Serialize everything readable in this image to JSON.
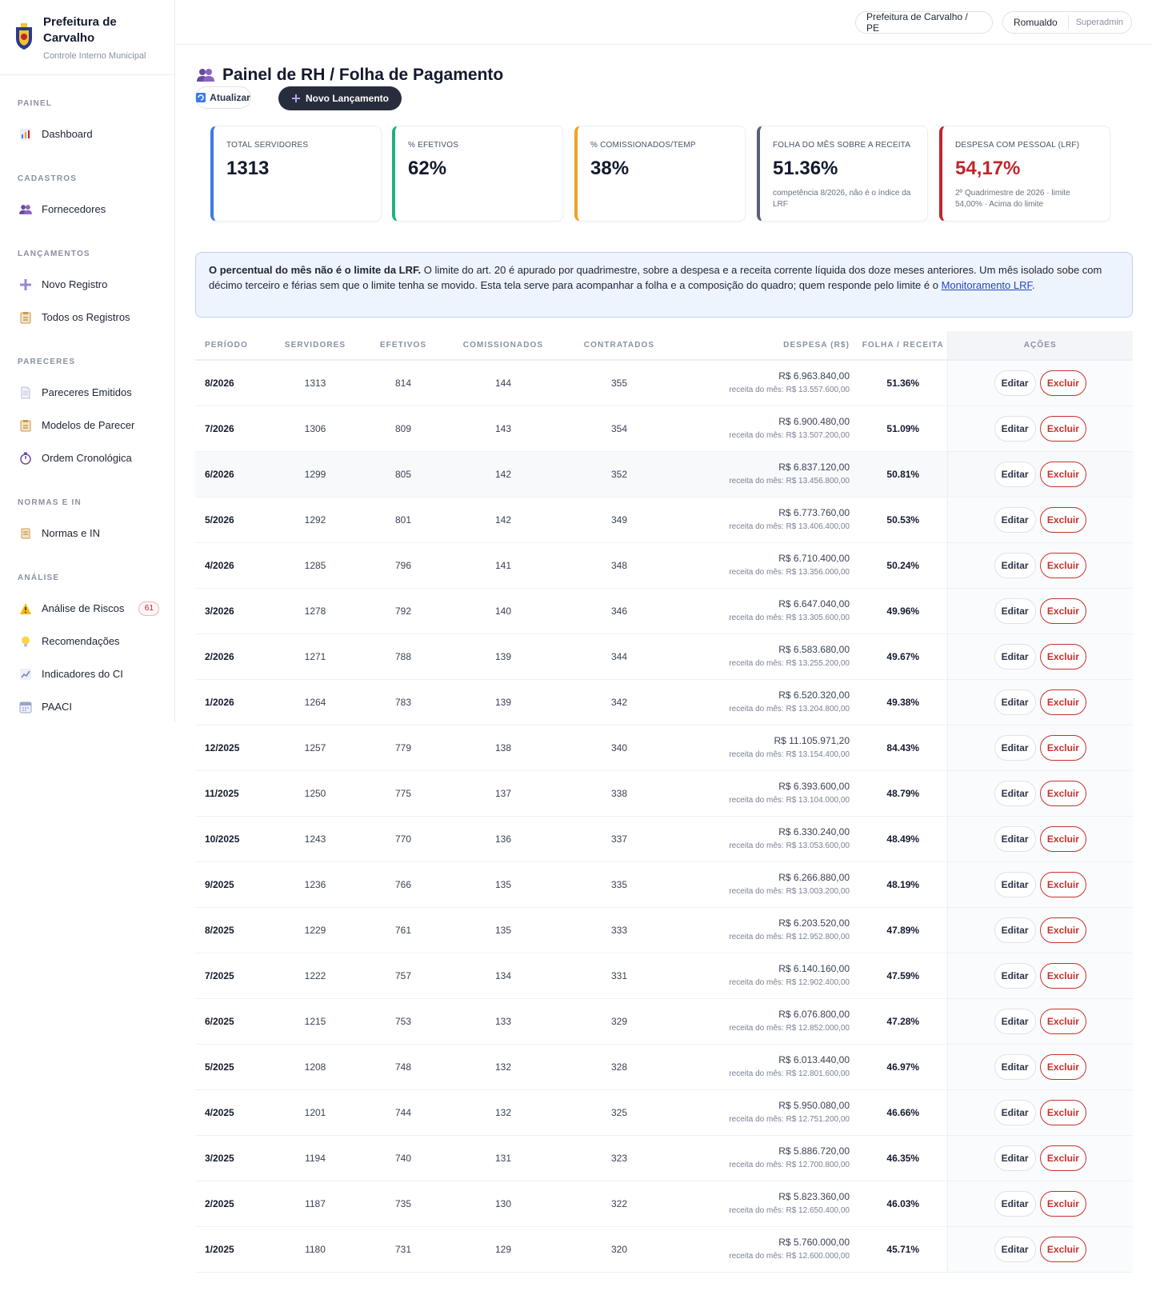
{
  "brand": {
    "title": "Prefeitura de Carvalho",
    "subtitle": "Controle Interno Municipal"
  },
  "sidebar": [
    {
      "heading": "PAINEL",
      "items": [
        {
          "label": "Dashboard",
          "icon": "bar-chart-icon"
        }
      ]
    },
    {
      "heading": "CADASTROS",
      "items": [
        {
          "label": "Fornecedores",
          "icon": "users-icon"
        }
      ]
    },
    {
      "heading": "LANÇAMENTOS",
      "items": [
        {
          "label": "Novo Registro",
          "icon": "plus-icon"
        },
        {
          "label": "Todos os Registros",
          "icon": "clipboard-icon"
        }
      ]
    },
    {
      "heading": "PARECERES",
      "items": [
        {
          "label": "Pareceres Emitidos",
          "icon": "document-icon"
        },
        {
          "label": "Modelos de Parecer",
          "icon": "clipboard-icon"
        },
        {
          "label": "Ordem Cronológica",
          "icon": "stopwatch-icon"
        }
      ]
    },
    {
      "heading": "NORMAS E IN",
      "items": [
        {
          "label": "Normas e IN",
          "icon": "scroll-icon"
        }
      ]
    },
    {
      "heading": "ANÁLISE",
      "items": [
        {
          "label": "Análise de Riscos",
          "icon": "warning-icon",
          "badge": "61"
        },
        {
          "label": "Recomendações",
          "icon": "lightbulb-icon"
        },
        {
          "label": "Indicadores do CI",
          "icon": "line-chart-icon"
        },
        {
          "label": "PAACI",
          "icon": "calendar-icon"
        }
      ]
    }
  ],
  "topbar": {
    "city": "Prefeitura de Carvalho / PE",
    "user": "Romualdo",
    "role": "Superadmin"
  },
  "header": {
    "title": "Painel de RH / Folha de Pagamento",
    "refresh_label": "Atualizar",
    "new_label": "Novo Lançamento"
  },
  "kpis": [
    {
      "label": "Total servidores",
      "value": "1313",
      "note": "",
      "color": "#3b7be8"
    },
    {
      "label": "% Efetivos",
      "value": "62%",
      "note": "",
      "color": "#1fb27a"
    },
    {
      "label": "% Comissionados/Temp",
      "value": "38%",
      "note": "",
      "color": "#f0a321"
    },
    {
      "label": "Folha do mês sobre a receita",
      "value": "51.36%",
      "note": "competência 8/2026, não é o índice da LRF",
      "color": "#5a6075"
    },
    {
      "label": "Despesa com pessoal (LRF)",
      "value": "54,17%",
      "note": "2º Quadrimestre de 2026 · limite 54,00% · Acima do limite",
      "color": "#c0262c",
      "value_color": "#c0262c"
    }
  ],
  "alert": {
    "strong": "O percentual do mês não é o limite da LRF.",
    "text": " O limite do art. 20 é apurado por quadrimestre, sobre a despesa e a receita corrente líquida dos doze meses anteriores. Um mês isolado sobe com décimo terceiro e férias sem que o limite tenha se movido. Esta tela serve para acompanhar a folha e a composição do quadro; quem responde pelo limite é o ",
    "link": "Monitoramento LRF",
    "end": "."
  },
  "table": {
    "headers": [
      "Período",
      "Servidores",
      "Efetivos",
      "Comissionados",
      "Contratados",
      "Despesa (R$)",
      "Folha / Receita",
      "Ações"
    ],
    "receita_prefix": "receita do mês: ",
    "edit_label": "Editar",
    "delete_label": "Excluir",
    "rows": [
      {
        "periodo": "8/2026",
        "servidores": "1313",
        "efetivos": "814",
        "comissionados": "144",
        "contratados": "355",
        "despesa": "R$ 6.963.840,00",
        "receita": "R$ 13.557.600,00",
        "pct": "51.36%"
      },
      {
        "periodo": "7/2026",
        "servidores": "1306",
        "efetivos": "809",
        "comissionados": "143",
        "contratados": "354",
        "despesa": "R$ 6.900.480,00",
        "receita": "R$ 13.507.200,00",
        "pct": "51.09%"
      },
      {
        "periodo": "6/2026",
        "servidores": "1299",
        "efetivos": "805",
        "comissionados": "142",
        "contratados": "352",
        "despesa": "R$ 6.837.120,00",
        "receita": "R$ 13.456.800,00",
        "pct": "50.81%"
      },
      {
        "periodo": "5/2026",
        "servidores": "1292",
        "efetivos": "801",
        "comissionados": "142",
        "contratados": "349",
        "despesa": "R$ 6.773.760,00",
        "receita": "R$ 13.406.400,00",
        "pct": "50.53%"
      },
      {
        "periodo": "4/2026",
        "servidores": "1285",
        "efetivos": "796",
        "comissionados": "141",
        "contratados": "348",
        "despesa": "R$ 6.710.400,00",
        "receita": "R$ 13.356.000,00",
        "pct": "50.24%"
      },
      {
        "periodo": "3/2026",
        "servidores": "1278",
        "efetivos": "792",
        "comissionados": "140",
        "contratados": "346",
        "despesa": "R$ 6.647.040,00",
        "receita": "R$ 13.305.600,00",
        "pct": "49.96%"
      },
      {
        "periodo": "2/2026",
        "servidores": "1271",
        "efetivos": "788",
        "comissionados": "139",
        "contratados": "344",
        "despesa": "R$ 6.583.680,00",
        "receita": "R$ 13.255.200,00",
        "pct": "49.67%"
      },
      {
        "periodo": "1/2026",
        "servidores": "1264",
        "efetivos": "783",
        "comissionados": "139",
        "contratados": "342",
        "despesa": "R$ 6.520.320,00",
        "receita": "R$ 13.204.800,00",
        "pct": "49.38%"
      },
      {
        "periodo": "12/2025",
        "servidores": "1257",
        "efetivos": "779",
        "comissionados": "138",
        "contratados": "340",
        "despesa": "R$ 11.105.971,20",
        "receita": "R$ 13.154.400,00",
        "pct": "84.43%"
      },
      {
        "periodo": "11/2025",
        "servidores": "1250",
        "efetivos": "775",
        "comissionados": "137",
        "contratados": "338",
        "despesa": "R$ 6.393.600,00",
        "receita": "R$ 13.104.000,00",
        "pct": "48.79%"
      },
      {
        "periodo": "10/2025",
        "servidores": "1243",
        "efetivos": "770",
        "comissionados": "136",
        "contratados": "337",
        "despesa": "R$ 6.330.240,00",
        "receita": "R$ 13.053.600,00",
        "pct": "48.49%"
      },
      {
        "periodo": "9/2025",
        "servidores": "1236",
        "efetivos": "766",
        "comissionados": "135",
        "contratados": "335",
        "despesa": "R$ 6.266.880,00",
        "receita": "R$ 13.003.200,00",
        "pct": "48.19%"
      },
      {
        "periodo": "8/2025",
        "servidores": "1229",
        "efetivos": "761",
        "comissionados": "135",
        "contratados": "333",
        "despesa": "R$ 6.203.520,00",
        "receita": "R$ 12.952.800,00",
        "pct": "47.89%"
      },
      {
        "periodo": "7/2025",
        "servidores": "1222",
        "efetivos": "757",
        "comissionados": "134",
        "contratados": "331",
        "despesa": "R$ 6.140.160,00",
        "receita": "R$ 12.902.400,00",
        "pct": "47.59%"
      },
      {
        "periodo": "6/2025",
        "servidores": "1215",
        "efetivos": "753",
        "comissionados": "133",
        "contratados": "329",
        "despesa": "R$ 6.076.800,00",
        "receita": "R$ 12.852.000,00",
        "pct": "47.28%"
      },
      {
        "periodo": "5/2025",
        "servidores": "1208",
        "efetivos": "748",
        "comissionados": "132",
        "contratados": "328",
        "despesa": "R$ 6.013.440,00",
        "receita": "R$ 12.801.600,00",
        "pct": "46.97%"
      },
      {
        "periodo": "4/2025",
        "servidores": "1201",
        "efetivos": "744",
        "comissionados": "132",
        "contratados": "325",
        "despesa": "R$ 5.950.080,00",
        "receita": "R$ 12.751.200,00",
        "pct": "46.66%"
      },
      {
        "periodo": "3/2025",
        "servidores": "1194",
        "efetivos": "740",
        "comissionados": "131",
        "contratados": "323",
        "despesa": "R$ 5.886.720,00",
        "receita": "R$ 12.700.800,00",
        "pct": "46.35%"
      },
      {
        "periodo": "2/2025",
        "servidores": "1187",
        "efetivos": "735",
        "comissionados": "130",
        "contratados": "322",
        "despesa": "R$ 5.823.360,00",
        "receita": "R$ 12.650.400,00",
        "pct": "46.03%"
      },
      {
        "periodo": "1/2025",
        "servidores": "1180",
        "efetivos": "731",
        "comissionados": "129",
        "contratados": "320",
        "despesa": "R$ 5.760.000,00",
        "receita": "R$ 12.600.000,00",
        "pct": "45.71%"
      }
    ]
  }
}
